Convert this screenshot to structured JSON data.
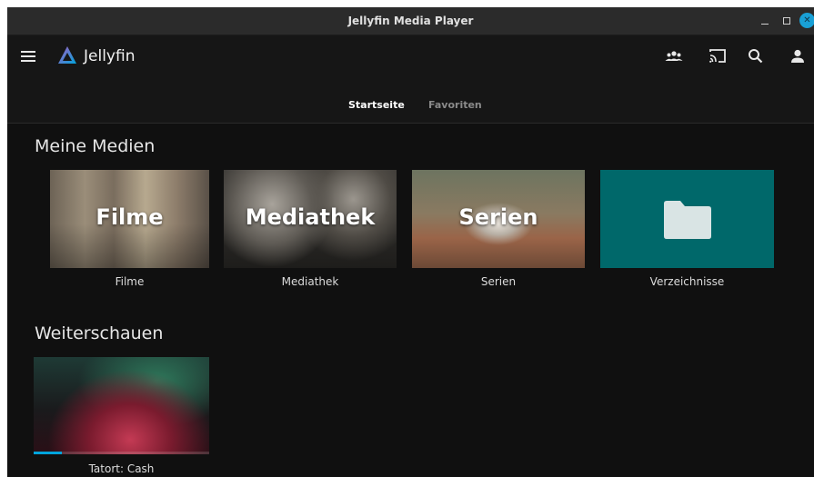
{
  "window": {
    "title": "Jellyfin Media Player",
    "accent": "#19a0d6"
  },
  "header": {
    "brand_name": "Jellyfin",
    "icons": [
      "menu-icon",
      "users-icon",
      "cast-icon",
      "search-icon",
      "user-icon"
    ],
    "tabs": [
      {
        "label": "Startseite",
        "active": true
      },
      {
        "label": "Favoriten",
        "active": false
      }
    ]
  },
  "sections": {
    "my_media": {
      "title": "Meine Medien",
      "items": [
        {
          "overlay": "Filme",
          "caption": "Filme"
        },
        {
          "overlay": "Mediathek",
          "caption": "Mediathek"
        },
        {
          "overlay": "Serien",
          "caption": "Serien"
        },
        {
          "overlay": "",
          "caption": "Verzeichnisse",
          "icon": "folder-icon",
          "color": "#00686a"
        }
      ]
    },
    "continue_watching": {
      "title": "Weiterschauen",
      "items": [
        {
          "caption": "Tatort: Cash",
          "progress": 0.16
        }
      ]
    }
  }
}
